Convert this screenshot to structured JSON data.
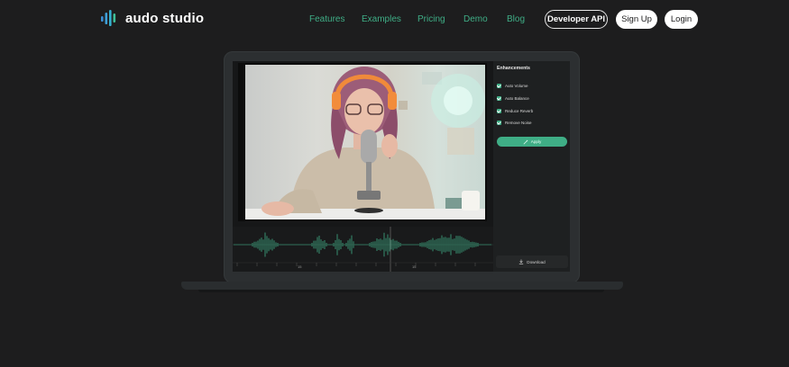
{
  "brand": {
    "name": "audo studio",
    "accent": "#3fae86"
  },
  "nav": {
    "items": [
      {
        "label": "Features",
        "name": "nav-link-features"
      },
      {
        "label": "Examples",
        "name": "nav-link-examples"
      },
      {
        "label": "Pricing",
        "name": "nav-link-pricing"
      },
      {
        "label": "Demo",
        "name": "nav-link-demo"
      },
      {
        "label": "Blog",
        "name": "nav-link-blog"
      }
    ],
    "developer_api": "Developer API",
    "sign_up": "Sign Up",
    "login": "Login"
  },
  "editor": {
    "panel_title": "Enhancements",
    "options": [
      {
        "label": "Auto Volume",
        "checked": true
      },
      {
        "label": "Auto Balance",
        "checked": true
      },
      {
        "label": "Reduce Reverb",
        "checked": true
      },
      {
        "label": "Remove Noise",
        "checked": true
      }
    ],
    "apply_label": "Apply",
    "download_label": "Download",
    "ruler_labels": [
      "15",
      "15"
    ]
  },
  "icons": {
    "logo": "audio-bars-logo",
    "apply": "magic-wand-icon",
    "download": "download-icon"
  }
}
